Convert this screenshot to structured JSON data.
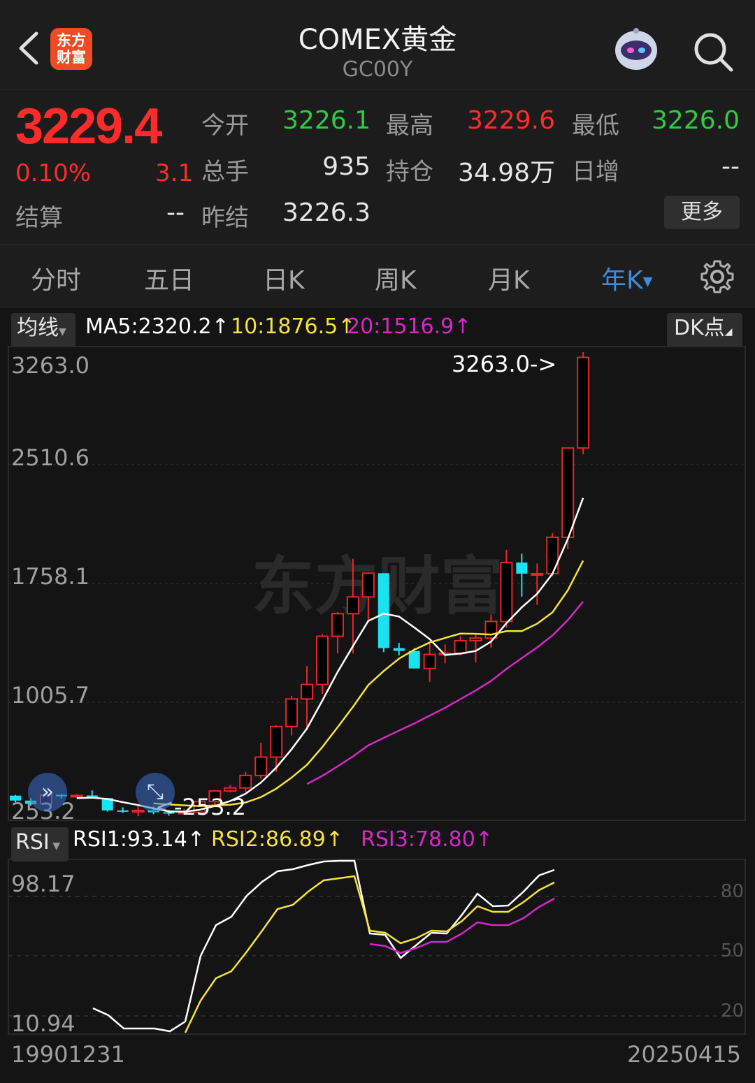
{
  "header": {
    "title": "COMEX黄金",
    "code": "GC00Y",
    "logo_text": "东方财富"
  },
  "quote": {
    "price": "3229.4",
    "change_pct": "0.10%",
    "change": "3.1",
    "settle_label": "结算",
    "settle_value": "--",
    "open_label": "今开",
    "open_value": "3226.1",
    "high_label": "最高",
    "high_value": "3229.6",
    "low_label": "最低",
    "low_value": "3226.0",
    "volume_label": "总手",
    "volume_value": "935",
    "oi_label": "持仓",
    "oi_value": "34.98万",
    "daily_inc_label": "日增",
    "daily_inc_value": "--",
    "prev_settle_label": "昨结",
    "prev_settle_value": "3226.3",
    "more_label": "更多",
    "up_color": "#ff2b2b",
    "down_color": "#2ecc40"
  },
  "tabs": [
    "分时",
    "五日",
    "日K",
    "周K",
    "月K",
    "年K"
  ],
  "active_tab": "年K",
  "indicator": {
    "ma_select": "均线",
    "ma5": "MA5:2320.2",
    "ma10": "10:1876.5",
    "ma20": "20:1516.9",
    "dk_label": "DK点",
    "rsi_select": "RSI",
    "rsi1": "RSI1:93.14",
    "rsi2": "RSI2:86.89",
    "rsi3": "RSI3:78.80",
    "arrow": "↑"
  },
  "chart_data": {
    "type": "candlestick",
    "y_ticks": [
      "3263.0",
      "2510.6",
      "1758.1",
      "1005.7",
      "253.2"
    ],
    "ylim": [
      253.2,
      3263.0
    ],
    "max_annotation": "3263.0->",
    "min_annotation": "<-253.2",
    "x_start": "19901231",
    "x_end": "20250415",
    "candles": [
      {
        "o": 386,
        "h": 391,
        "l": 343,
        "c": 354
      },
      {
        "o": 354,
        "h": 369,
        "l": 320,
        "c": 333
      },
      {
        "o": 333,
        "h": 407,
        "l": 327,
        "c": 391
      },
      {
        "o": 391,
        "h": 397,
        "l": 369,
        "c": 383
      },
      {
        "o": 383,
        "h": 396,
        "l": 374,
        "c": 387
      },
      {
        "o": 387,
        "h": 420,
        "l": 380,
        "c": 370
      },
      {
        "o": 370,
        "h": 370,
        "l": 283,
        "c": 290
      },
      {
        "o": 290,
        "h": 310,
        "l": 273,
        "c": 287
      },
      {
        "o": 287,
        "h": 326,
        "l": 252,
        "c": 290
      },
      {
        "o": 290,
        "h": 317,
        "l": 265,
        "c": 278
      },
      {
        "o": 278,
        "h": 293,
        "l": 256,
        "c": 276
      },
      {
        "o": 276,
        "h": 301,
        "l": 262,
        "c": 278
      },
      {
        "o": 278,
        "h": 354,
        "l": 277,
        "c": 347
      },
      {
        "o": 347,
        "h": 421,
        "l": 319,
        "c": 416
      },
      {
        "o": 416,
        "h": 455,
        "l": 407,
        "c": 436
      },
      {
        "o": 436,
        "h": 540,
        "l": 411,
        "c": 517
      },
      {
        "o": 517,
        "h": 729,
        "l": 496,
        "c": 636
      },
      {
        "o": 636,
        "h": 842,
        "l": 540,
        "c": 834
      },
      {
        "o": 834,
        "h": 1033,
        "l": 776,
        "c": 1013
      },
      {
        "o": 1013,
        "h": 1226,
        "l": 810,
        "c": 1107
      },
      {
        "o": 1107,
        "h": 1434,
        "l": 1045,
        "c": 1420
      },
      {
        "o": 1420,
        "h": 1577,
        "l": 1309,
        "c": 1566
      },
      {
        "o": 1566,
        "h": 1923,
        "l": 1308,
        "c": 1675
      },
      {
        "o": 1675,
        "h": 1795,
        "l": 1524,
        "c": 1829
      },
      {
        "o": 1829,
        "h": 1829,
        "l": 1318,
        "c": 1343
      },
      {
        "o": 1343,
        "h": 1377,
        "l": 1296,
        "c": 1325
      },
      {
        "o": 1325,
        "h": 1342,
        "l": 1211,
        "c": 1211
      },
      {
        "o": 1211,
        "h": 1375,
        "l": 1124,
        "c": 1302
      },
      {
        "o": 1302,
        "h": 1367,
        "l": 1244,
        "c": 1309
      },
      {
        "o": 1309,
        "h": 1419,
        "l": 1296,
        "c": 1391
      },
      {
        "o": 1391,
        "h": 1430,
        "l": 1250,
        "c": 1408
      },
      {
        "o": 1408,
        "h": 1561,
        "l": 1344,
        "c": 1516
      },
      {
        "o": 1516,
        "h": 1981,
        "l": 1475,
        "c": 1898
      },
      {
        "o": 1898,
        "h": 1955,
        "l": 1677,
        "c": 1826
      },
      {
        "o": 1826,
        "h": 1892,
        "l": 1623,
        "c": 1826
      },
      {
        "o": 1826,
        "h": 2089,
        "l": 1810,
        "c": 2062
      },
      {
        "o": 2062,
        "h": 2449,
        "l": 1985,
        "c": 2641
      },
      {
        "o": 2641,
        "h": 3263,
        "l": 2600,
        "c": 3229
      }
    ],
    "rsi_ticks": [
      "98.17",
      "10.94"
    ],
    "rsi_ref": [
      "80",
      "50",
      "20"
    ]
  }
}
